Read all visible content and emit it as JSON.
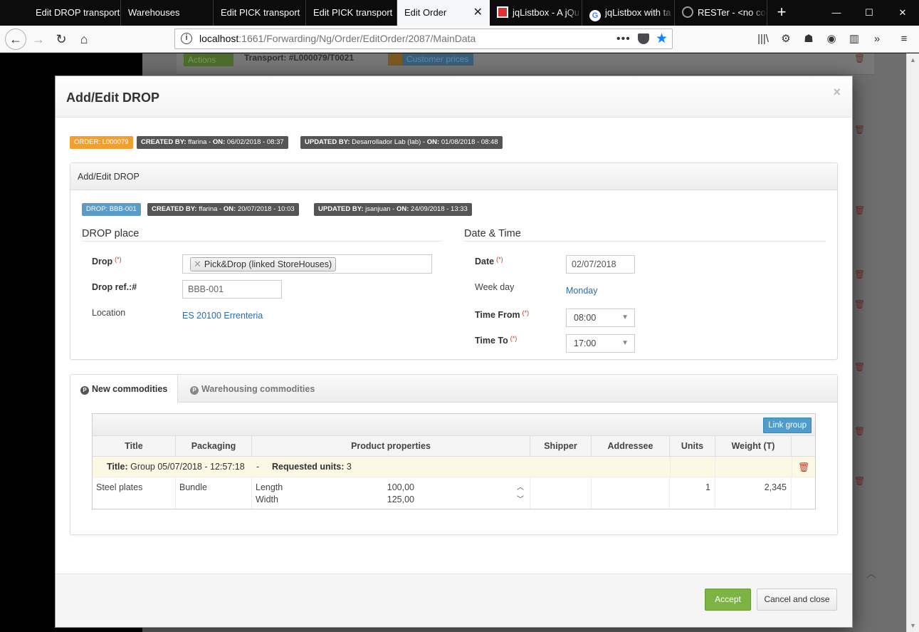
{
  "browser": {
    "tabs": [
      {
        "label": "Edit DROP transport"
      },
      {
        "label": "Warehouses"
      },
      {
        "label": "Edit PICK transport"
      },
      {
        "label": "Edit PICK transport"
      },
      {
        "label": "Edit Order"
      },
      {
        "label": "jqListbox - A jQu"
      },
      {
        "label": "jqListbox with ta"
      },
      {
        "label": "RESTer - <no col"
      }
    ],
    "url_host": "localhost",
    "url_rest": ":1661/Forwarding/Ng/Order/EditOrder/2087/MainData",
    "url_more": "•••"
  },
  "background": {
    "actions_label": "Actions",
    "transport_label": "Transport: #L000079/T0021",
    "customer_prices_label": "Customer prices"
  },
  "modal": {
    "title": "Add/Edit DROP",
    "close_glyph": "×",
    "order_badge": "ORDER: L000079",
    "created_badge_key": "CREATED BY:",
    "created_badge_user": " ffarina - ",
    "created_badge_on_key": "ON:",
    "created_badge_on": " 06/02/2018 - 08:37",
    "updated_badge_key": "UPDATED BY:",
    "updated_badge_user": " Desarrollador Lab (lab) - ",
    "updated_badge_on_key": "ON:",
    "updated_badge_on": " 01/08/2018 - 08:48",
    "drop_box": {
      "title": "Add/Edit DROP",
      "drop_badge": "DROP: BBB-001",
      "created_key": "CREATED BY:",
      "created_user": " ffarina - ",
      "created_on_key": "ON:",
      "created_on": " 20/07/2018 - 10:03",
      "updated_key": "UPDATED BY:",
      "updated_user": " jsanjuan - ",
      "updated_on_key": "ON:",
      "updated_on": " 24/09/2018 - 13:33",
      "place_heading": "DROP place",
      "drop_label": "Drop",
      "required_mark": "(*)",
      "drop_value": "Pick&Drop (linked StoreHouses)",
      "drop_ref_label": "Drop ref.:#",
      "drop_ref_value": "BBB-001",
      "location_label": "Location",
      "location_value": "ES 20100 Errenteria",
      "datetime_heading": "Date & Time",
      "date_label": "Date",
      "date_value": "02/07/2018",
      "weekday_label": "Week day",
      "weekday_value": "Monday",
      "time_from_label": "Time From",
      "time_from_value": "08:00",
      "time_to_label": "Time To",
      "time_to_value": "17:00"
    },
    "commodities": {
      "tab_new": "New commodities",
      "tab_warehousing": "Warehousing commodities",
      "tab_icon_glyph": "P",
      "link_group_label": "Link group",
      "columns": [
        "Title",
        "Packaging",
        "Product properties",
        "Shipper",
        "Addressee",
        "Units",
        "Weight (T)"
      ],
      "group_row": {
        "title_key": "Title:",
        "title_value": " Group 05/07/2018 - 12:57:18",
        "separator": "-",
        "requested_key": "Requested units:",
        "requested_value": " 3"
      },
      "rows": [
        {
          "title": "Steel plates",
          "packaging": "Bundle",
          "prop1_name": "Length",
          "prop1_value": "100,00",
          "prop2_name": "Width",
          "prop2_value": "125,00",
          "shipper": "",
          "addressee": "",
          "units": "1",
          "weight": "2,345"
        }
      ]
    },
    "footer": {
      "accept_label": "Accept",
      "cancel_label": "Cancel and close"
    }
  }
}
